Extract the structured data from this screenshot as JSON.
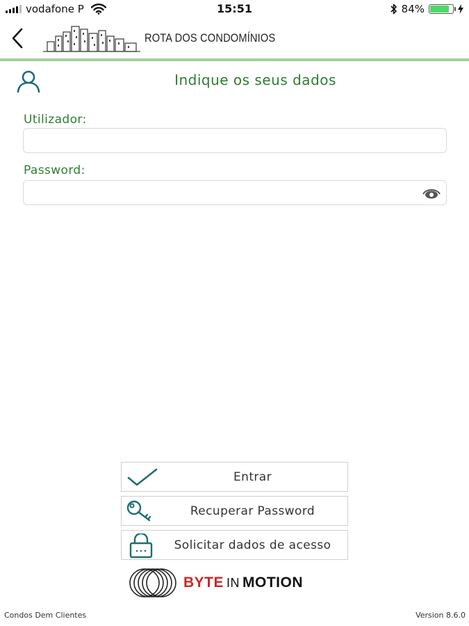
{
  "status": {
    "carrier": "vodafone P",
    "time": "15:51",
    "battery_text": "84%",
    "battery_level": 0.84
  },
  "nav": {
    "brand": "ROTA DOS CONDOMÍNIOS"
  },
  "form": {
    "heading": "Indique os seus dados",
    "username_label": "Utilizador:",
    "username_value": "",
    "password_label": "Password:",
    "password_value": ""
  },
  "actions": {
    "login_label": "Entrar",
    "recover_label": "Recuperar Password",
    "request_label": "Solicitar dados de acesso"
  },
  "branding": {
    "byte": "BYTE",
    "in": "IN",
    "motion": "MOTION"
  },
  "footer": {
    "left": "Condos Dem Clientes",
    "version": "Version 8.6.0"
  },
  "colors": {
    "accent_green": "#2e7d32",
    "icon_teal": "#1f6f6f",
    "nav_border": "#a3cf9a",
    "battery_green": "#4cd964",
    "brand_red": "#c62828"
  },
  "icons": {
    "back": "chevron-left-icon",
    "user": "user-icon",
    "password_toggle": "eye-icon",
    "login": "checkmark-icon",
    "recover": "key-icon",
    "request": "lock-icon",
    "wifi": "wifi-icon",
    "bluetooth": "bluetooth-icon",
    "charging": "lightning-icon"
  }
}
